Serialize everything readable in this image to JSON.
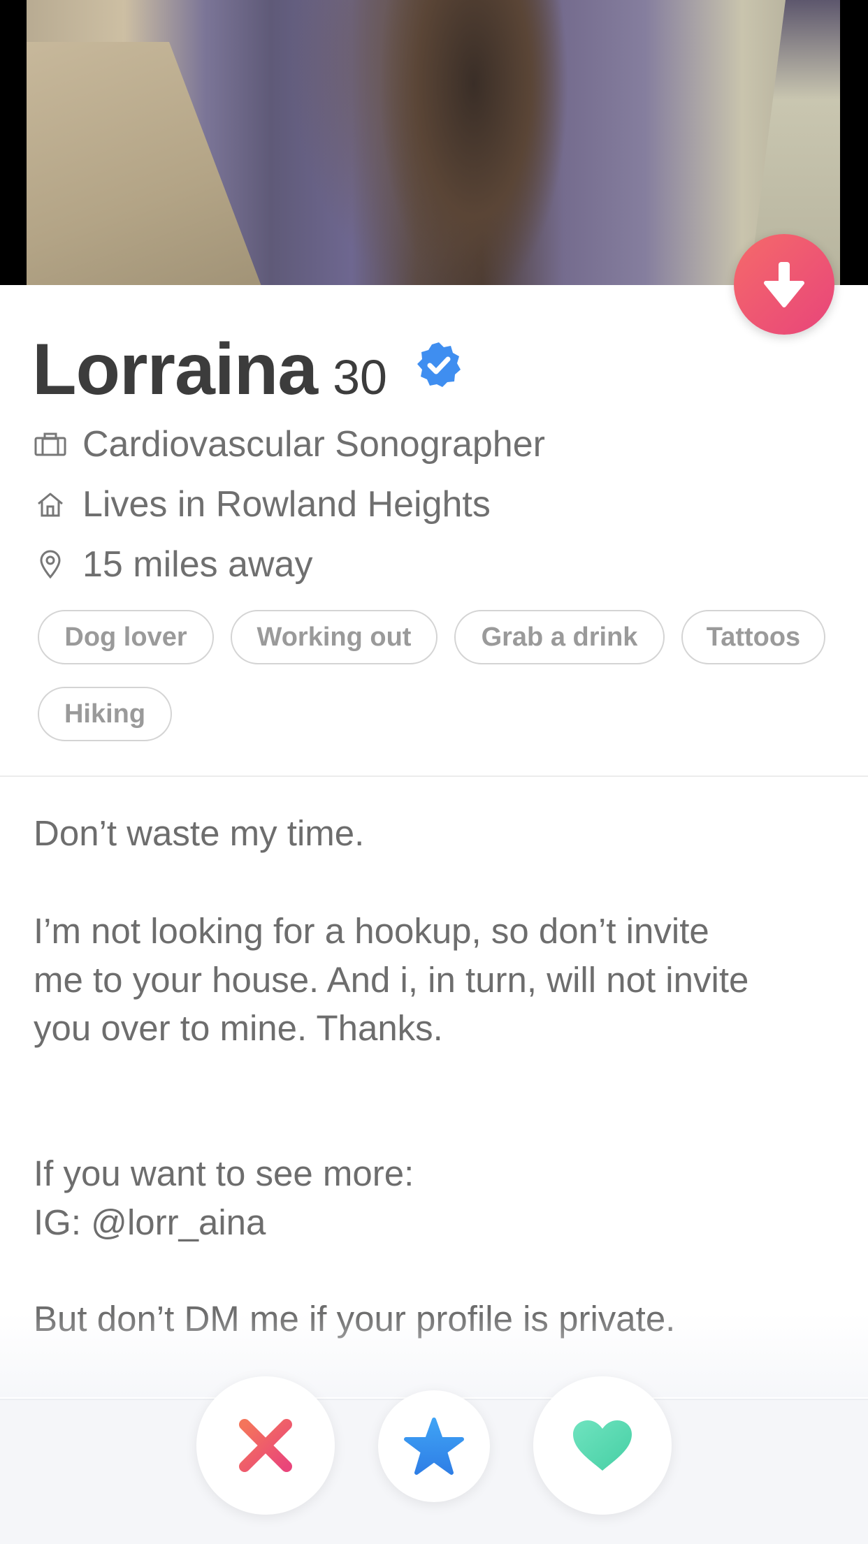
{
  "profile": {
    "name": "Lorraina",
    "age": "30",
    "job": "Cardiovascular Sonographer",
    "lives": "Lives in Rowland Heights",
    "distance": "15 miles away"
  },
  "interests": [
    "Dog lover",
    "Working out",
    "Grab a drink",
    "Tattoos",
    "Hiking"
  ],
  "bio": {
    "line1": "Don’t waste my time.",
    "line2": "I’m not looking for a hookup, so don’t invite",
    "line3": "me to your house. And i, in turn, will not invite",
    "line4": "you over to mine. Thanks.",
    "line5": "If you want to see more:",
    "line6": "IG:  @lorr_aina",
    "line7": "But don’t DM me if your profile is private."
  },
  "icons": {
    "collapse": "arrow-down-icon",
    "verified": "verified-badge-icon",
    "job": "briefcase-icon",
    "home": "home-icon",
    "location": "location-pin-icon",
    "nope": "close-icon",
    "super_like": "star-icon",
    "like": "heart-icon"
  },
  "colors": {
    "accent_gradient_start": "#f56a6a",
    "accent_gradient_end": "#e8457a",
    "verified_blue": "#3f8ef0",
    "super_like_blue": "#2f8ff0",
    "like_green": "#5ad9b0"
  }
}
